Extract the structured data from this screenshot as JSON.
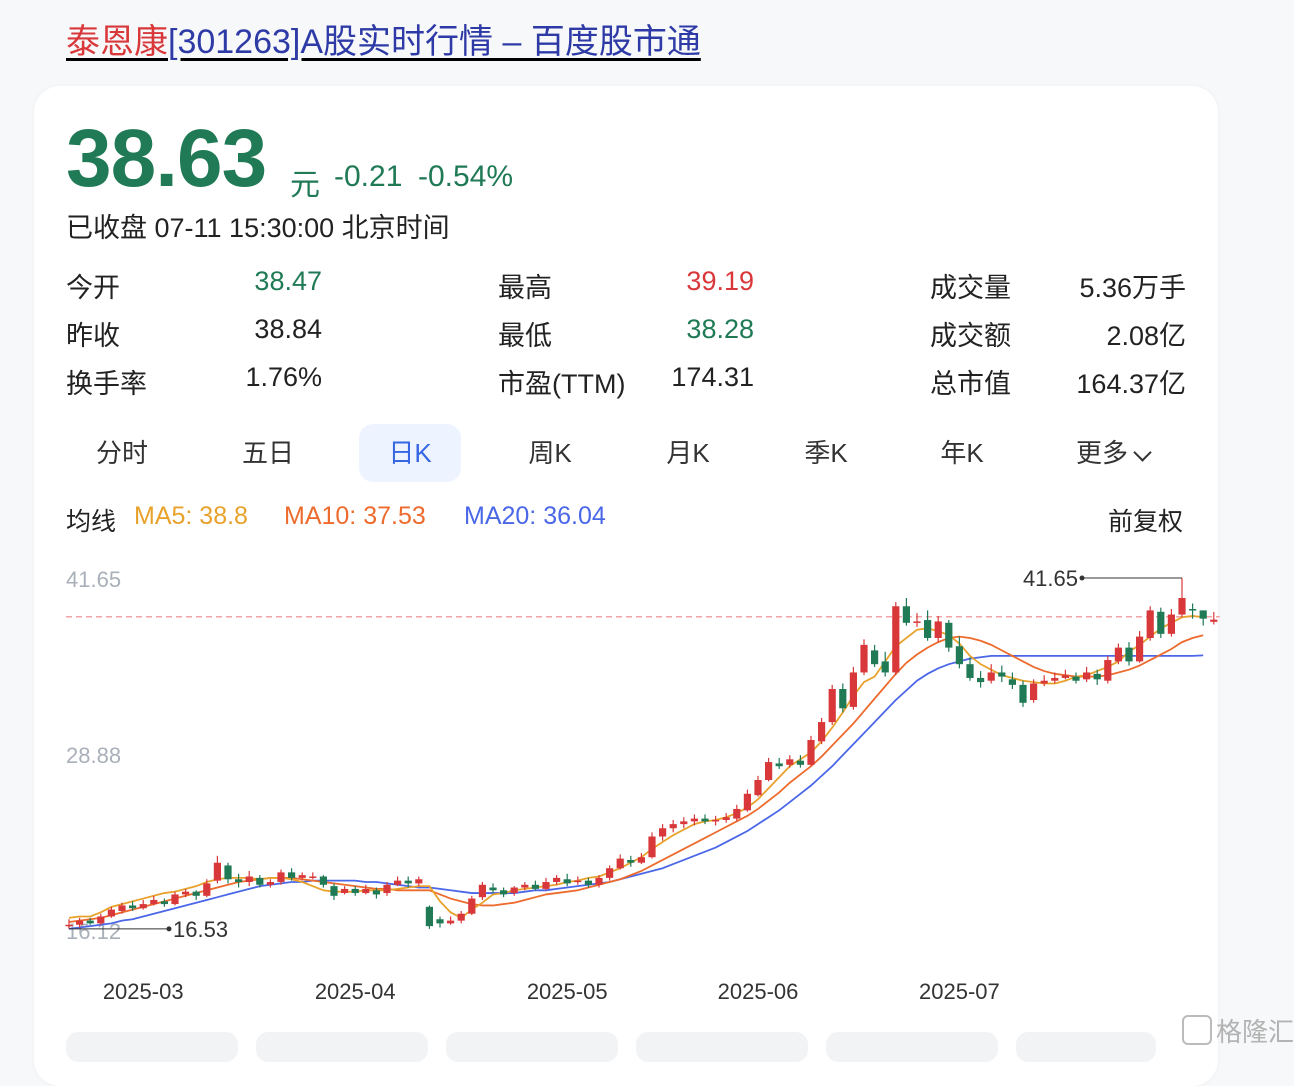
{
  "title": {
    "name": "泰恩康",
    "rest": "[301263]A股实时行情 – 百度股市通"
  },
  "quote": {
    "price": "38.63",
    "unit": "元",
    "change": "-0.21",
    "change_pct": "-0.54%",
    "status": "已收盘 07-11 15:30:00 北京时间"
  },
  "stats": [
    {
      "label": "今开",
      "value": "38.47",
      "color": "#1f7a55"
    },
    {
      "label": "最高",
      "value": "39.19",
      "color": "#d9383a"
    },
    {
      "label": "成交量",
      "value": "5.36万手",
      "color": "#222222"
    },
    {
      "label": "昨收",
      "value": "38.84",
      "color": "#222222"
    },
    {
      "label": "最低",
      "value": "38.28",
      "color": "#1f7a55"
    },
    {
      "label": "成交额",
      "value": "2.08亿",
      "color": "#222222"
    },
    {
      "label": "换手率",
      "value": "1.76%",
      "color": "#222222"
    },
    {
      "label": "市盈(TTM)",
      "value": "174.31",
      "color": "#222222"
    },
    {
      "label": "总市值",
      "value": "164.37亿",
      "color": "#222222"
    }
  ],
  "tabs": [
    "分时",
    "五日",
    "日K",
    "周K",
    "月K",
    "季K",
    "年K",
    "更多"
  ],
  "active_tab": "日K",
  "ma": {
    "label": "均线",
    "ma5": "MA5: 38.8",
    "ma10": "MA10: 37.53",
    "ma20": "MA20: 36.04",
    "adjust": "前复权"
  },
  "colors": {
    "up": "#d9383a",
    "down": "#1f7a55",
    "ma5": "#e8a22c",
    "ma10": "#ec6b2d",
    "ma20": "#4a67e8",
    "ref": "#f2a3a6"
  },
  "watermark": "格隆汇",
  "chart_data": {
    "type": "candlestick",
    "y_ticks": [
      "41.65",
      "28.88",
      "16.12"
    ],
    "ylim": [
      16.12,
      41.65
    ],
    "x_labels": [
      "2025-03",
      "2025-04",
      "2025-05",
      "2025-06",
      "2025-07"
    ],
    "reference_close": 38.84,
    "max_label": "41.65",
    "min_label": "16.53",
    "x_label_index": [
      7,
      27,
      47,
      65,
      84
    ],
    "candles": [
      [
        16.4,
        16.5,
        16.9,
        16.2
      ],
      [
        16.5,
        16.8,
        17.0,
        16.3
      ],
      [
        16.8,
        16.6,
        17.0,
        16.5
      ],
      [
        16.6,
        17.1,
        17.3,
        16.5
      ],
      [
        17.1,
        17.6,
        17.8,
        17.0
      ],
      [
        17.5,
        17.9,
        18.1,
        17.3
      ],
      [
        17.9,
        17.7,
        18.2,
        17.5
      ],
      [
        17.7,
        18.0,
        18.3,
        17.6
      ],
      [
        18.0,
        18.3,
        18.6,
        17.9
      ],
      [
        18.2,
        18.0,
        18.4,
        17.8
      ],
      [
        18.0,
        18.7,
        18.9,
        17.9
      ],
      [
        18.7,
        18.9,
        19.1,
        18.5
      ],
      [
        18.9,
        18.6,
        19.0,
        18.3
      ],
      [
        18.6,
        19.5,
        19.8,
        18.5
      ],
      [
        19.7,
        21.0,
        21.5,
        19.5
      ],
      [
        20.8,
        19.8,
        21.0,
        19.5
      ],
      [
        19.8,
        19.6,
        20.2,
        19.2
      ],
      [
        19.6,
        20.0,
        20.4,
        19.3
      ],
      [
        19.9,
        19.4,
        20.1,
        19.2
      ],
      [
        19.4,
        19.6,
        19.8,
        19.2
      ],
      [
        19.6,
        20.3,
        20.5,
        19.4
      ],
      [
        20.3,
        19.9,
        20.6,
        19.7
      ],
      [
        19.9,
        20.1,
        20.3,
        19.7
      ],
      [
        20.0,
        20.0,
        20.3,
        19.8
      ],
      [
        20.0,
        19.4,
        20.1,
        19.2
      ],
      [
        19.3,
        18.6,
        19.5,
        18.3
      ],
      [
        18.8,
        19.1,
        19.3,
        18.7
      ],
      [
        19.1,
        18.8,
        19.3,
        18.6
      ],
      [
        18.8,
        19.1,
        19.4,
        18.7
      ],
      [
        19.0,
        18.7,
        19.2,
        18.4
      ],
      [
        18.8,
        19.4,
        19.6,
        18.6
      ],
      [
        19.4,
        19.7,
        20.0,
        19.3
      ],
      [
        19.7,
        19.5,
        20.0,
        19.2
      ],
      [
        19.5,
        19.8,
        20.0,
        19.3
      ],
      [
        17.8,
        16.4,
        17.9,
        16.2
      ],
      [
        16.9,
        16.6,
        17.1,
        16.3
      ],
      [
        16.6,
        16.8,
        17.1,
        16.5
      ],
      [
        16.8,
        17.3,
        17.5,
        16.6
      ],
      [
        17.3,
        18.4,
        18.6,
        17.2
      ],
      [
        18.5,
        19.4,
        19.6,
        18.3
      ],
      [
        19.2,
        19.0,
        19.5,
        18.8
      ],
      [
        19.0,
        18.7,
        19.2,
        18.5
      ],
      [
        18.8,
        19.2,
        19.3,
        18.6
      ],
      [
        19.2,
        19.4,
        19.6,
        19.0
      ],
      [
        19.4,
        19.1,
        19.7,
        19.0
      ],
      [
        19.1,
        19.6,
        19.9,
        19.0
      ],
      [
        19.6,
        19.9,
        20.1,
        19.4
      ],
      [
        19.8,
        19.5,
        20.2,
        19.3
      ],
      [
        19.6,
        19.7,
        20.0,
        19.4
      ],
      [
        19.7,
        19.4,
        19.9,
        19.2
      ],
      [
        19.4,
        19.9,
        20.1,
        19.2
      ],
      [
        19.9,
        20.6,
        20.8,
        19.7
      ],
      [
        20.6,
        21.3,
        21.6,
        20.5
      ],
      [
        21.2,
        21.0,
        21.5,
        20.7
      ],
      [
        21.0,
        21.4,
        21.7,
        20.9
      ],
      [
        21.4,
        22.9,
        23.2,
        21.3
      ],
      [
        22.9,
        23.5,
        23.8,
        22.6
      ],
      [
        23.5,
        23.8,
        24.1,
        23.2
      ],
      [
        23.8,
        24.0,
        24.3,
        23.5
      ],
      [
        24.0,
        24.2,
        24.5,
        23.7
      ],
      [
        24.2,
        24.0,
        24.5,
        23.8
      ],
      [
        24.0,
        24.1,
        24.4,
        23.7
      ],
      [
        24.1,
        24.3,
        24.6,
        23.9
      ],
      [
        24.2,
        24.9,
        25.2,
        24.0
      ],
      [
        24.8,
        26.0,
        26.3,
        24.7
      ],
      [
        25.9,
        27.0,
        27.3,
        25.8
      ],
      [
        27.0,
        28.3,
        28.6,
        26.9
      ],
      [
        28.2,
        28.0,
        28.6,
        27.8
      ],
      [
        28.1,
        28.5,
        28.8,
        27.9
      ],
      [
        28.4,
        28.1,
        28.8,
        27.9
      ],
      [
        28.1,
        29.9,
        30.2,
        28.0
      ],
      [
        29.8,
        31.2,
        31.5,
        29.6
      ],
      [
        31.2,
        33.6,
        33.9,
        31.0
      ],
      [
        33.6,
        32.2,
        34.0,
        31.9
      ],
      [
        32.3,
        34.8,
        35.2,
        32.1
      ],
      [
        34.8,
        36.8,
        37.2,
        34.6
      ],
      [
        36.4,
        35.4,
        36.8,
        35.2
      ],
      [
        35.6,
        34.8,
        36.3,
        34.5
      ],
      [
        34.8,
        39.6,
        39.9,
        34.6
      ],
      [
        39.6,
        38.4,
        40.2,
        38.2
      ],
      [
        38.4,
        38.5,
        39.1,
        38.1
      ],
      [
        38.6,
        37.3,
        39.3,
        37.1
      ],
      [
        37.3,
        38.5,
        38.9,
        37.0
      ],
      [
        38.4,
        36.6,
        38.6,
        36.3
      ],
      [
        36.7,
        35.4,
        37.4,
        35.1
      ],
      [
        35.4,
        34.4,
        35.9,
        34.2
      ],
      [
        34.4,
        34.1,
        34.9,
        33.7
      ],
      [
        34.2,
        34.8,
        35.4,
        34.0
      ],
      [
        34.8,
        34.5,
        35.3,
        34.1
      ],
      [
        34.3,
        33.9,
        34.8,
        33.6
      ],
      [
        33.9,
        32.6,
        34.2,
        32.3
      ],
      [
        32.8,
        34.0,
        34.3,
        32.6
      ],
      [
        34.0,
        34.2,
        34.6,
        33.8
      ],
      [
        34.2,
        34.4,
        34.8,
        34.0
      ],
      [
        34.4,
        34.6,
        35.0,
        34.3
      ],
      [
        34.5,
        34.2,
        34.8,
        34.0
      ],
      [
        34.3,
        34.8,
        35.2,
        34.1
      ],
      [
        34.7,
        34.3,
        35.0,
        33.9
      ],
      [
        34.2,
        35.7,
        36.0,
        34.0
      ],
      [
        35.6,
        36.6,
        36.9,
        35.4
      ],
      [
        36.6,
        35.6,
        37.0,
        35.3
      ],
      [
        35.6,
        37.4,
        37.8,
        35.5
      ],
      [
        37.3,
        39.3,
        39.6,
        37.1
      ],
      [
        39.2,
        37.6,
        39.5,
        37.3
      ],
      [
        37.6,
        39.0,
        39.4,
        37.4
      ],
      [
        39.0,
        40.2,
        41.65,
        38.8
      ],
      [
        39.4,
        39.3,
        39.8,
        38.7
      ],
      [
        39.3,
        38.7,
        39.3,
        38.2
      ],
      [
        38.47,
        38.63,
        39.19,
        38.28
      ]
    ],
    "ma5": [
      17.0,
      17.1,
      17.1,
      17.4,
      17.8,
      18.0,
      18.2,
      18.4,
      18.6,
      18.8,
      18.9,
      19.1,
      19.3,
      19.6,
      19.8,
      19.9,
      19.9,
      19.9,
      19.8,
      19.9,
      19.9,
      19.8,
      19.6,
      19.3,
      19.0,
      18.9,
      18.9,
      18.9,
      19.0,
      19.0,
      19.0,
      19.1,
      19.2,
      19.3,
      19.3,
      18.2,
      17.4,
      17.0,
      17.6,
      18.1,
      18.7,
      18.8,
      19.0,
      19.1,
      19.2,
      19.3,
      19.4,
      19.6,
      19.7,
      19.9,
      20.0,
      20.3,
      20.6,
      21.0,
      21.4,
      22.0,
      22.5,
      23.0,
      23.4,
      23.8,
      24.0,
      24.1,
      24.3,
      24.6,
      25.0,
      25.6,
      26.4,
      27.2,
      28.0,
      28.5,
      29.0,
      29.8,
      30.8,
      31.9,
      33.1,
      34.1,
      34.5,
      35.6,
      36.7,
      37.3,
      37.9,
      38.0,
      37.8,
      37.5,
      36.9,
      36.0,
      35.4,
      35.0,
      34.6,
      34.4,
      34.2,
      34.1,
      34.0,
      34.0,
      34.2,
      34.5,
      34.6,
      34.9,
      35.2,
      35.6,
      36.3,
      36.8,
      37.4,
      38.0,
      38.4,
      38.8,
      38.9,
      38.8
    ],
    "ma10": [
      16.7,
      16.8,
      16.9,
      17.0,
      17.2,
      17.4,
      17.6,
      17.8,
      18.0,
      18.2,
      18.4,
      18.6,
      18.8,
      19.0,
      19.2,
      19.4,
      19.6,
      19.7,
      19.8,
      19.9,
      19.9,
      19.9,
      19.8,
      19.7,
      19.6,
      19.5,
      19.4,
      19.3,
      19.2,
      19.1,
      19.1,
      19.0,
      19.0,
      19.0,
      19.0,
      18.7,
      18.4,
      18.2,
      18.0,
      17.9,
      17.9,
      18.0,
      18.1,
      18.3,
      18.5,
      18.7,
      18.8,
      18.9,
      19.0,
      19.2,
      19.4,
      19.6,
      19.8,
      20.1,
      20.4,
      20.8,
      21.2,
      21.6,
      22.0,
      22.4,
      22.8,
      23.2,
      23.6,
      24.0,
      24.4,
      24.9,
      25.5,
      26.1,
      26.8,
      27.4,
      28.0,
      28.7,
      29.5,
      30.3,
      31.1,
      32.0,
      32.9,
      33.8,
      34.7,
      35.5,
      36.1,
      36.6,
      37.0,
      37.3,
      37.4,
      37.3,
      37.1,
      36.8,
      36.4,
      36.0,
      35.6,
      35.2,
      34.9,
      34.7,
      34.6,
      34.5,
      34.5,
      34.5,
      34.6,
      34.8,
      35.0,
      35.3,
      35.7,
      36.1,
      36.5,
      37.0,
      37.3,
      37.5
    ],
    "ma20": [
      16.2,
      16.3,
      16.4,
      16.5,
      16.6,
      16.8,
      16.9,
      17.1,
      17.3,
      17.5,
      17.7,
      17.9,
      18.1,
      18.3,
      18.5,
      18.7,
      18.9,
      19.1,
      19.3,
      19.4,
      19.5,
      19.6,
      19.6,
      19.7,
      19.7,
      19.7,
      19.7,
      19.7,
      19.6,
      19.6,
      19.5,
      19.4,
      19.3,
      19.2,
      19.2,
      19.1,
      19.0,
      18.9,
      18.8,
      18.8,
      18.8,
      18.8,
      18.8,
      18.9,
      19.0,
      19.0,
      19.1,
      19.2,
      19.3,
      19.4,
      19.5,
      19.6,
      19.8,
      20.0,
      20.2,
      20.4,
      20.6,
      20.9,
      21.2,
      21.5,
      21.8,
      22.1,
      22.5,
      22.9,
      23.3,
      23.8,
      24.3,
      24.8,
      25.4,
      26.0,
      26.6,
      27.3,
      28.0,
      28.8,
      29.6,
      30.4,
      31.2,
      32.0,
      32.8,
      33.5,
      34.2,
      34.7,
      35.1,
      35.4,
      35.6,
      35.8,
      35.9,
      36.0,
      36.0,
      36.0,
      36.0,
      36.0,
      36.0,
      36.0,
      36.0,
      36.0,
      36.0,
      36.0,
      36.0,
      36.0,
      36.0,
      36.0,
      36.0,
      36.0,
      36.0,
      36.0,
      36.0,
      36.04
    ]
  }
}
